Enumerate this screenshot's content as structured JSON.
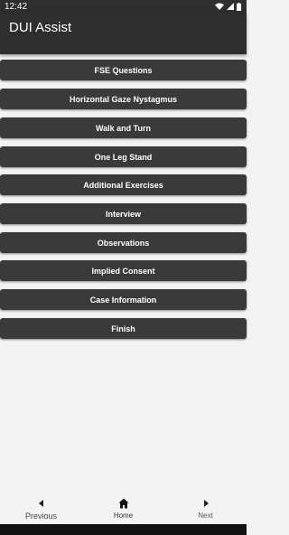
{
  "status_bar": {
    "time": "12:42"
  },
  "app_bar": {
    "title": "DUI Assist"
  },
  "menu": [
    {
      "label": "FSE Questions"
    },
    {
      "label": "Horizontal Gaze Nystagmus"
    },
    {
      "label": "Walk and Turn"
    },
    {
      "label": "One Leg Stand"
    },
    {
      "label": "Additional Exercises"
    },
    {
      "label": "Interview"
    },
    {
      "label": "Observations"
    },
    {
      "label": "Implied Consent"
    },
    {
      "label": "Case Information"
    },
    {
      "label": "Finish"
    }
  ],
  "bottom_nav": {
    "previous": {
      "label": "Previous",
      "icon": "caret-left-icon"
    },
    "home": {
      "label": "Home",
      "icon": "home-icon"
    },
    "next": {
      "label": "Next",
      "icon": "caret-right-icon"
    }
  },
  "colors": {
    "app_bar": "#2e2e2e",
    "button": "#3a3a3a",
    "background": "#f3f3f3"
  }
}
